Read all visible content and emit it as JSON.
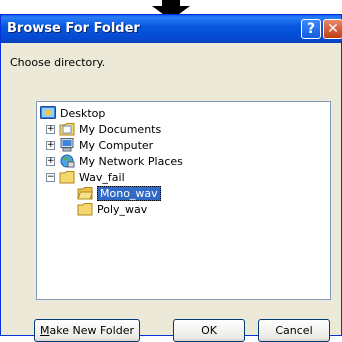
{
  "dialog": {
    "title": "Browse For Folder",
    "help_glyph": "?",
    "close_glyph": "✕",
    "prompt": "Choose directory."
  },
  "tree": {
    "expander_collapsed": "+",
    "expander_expanded": "−",
    "items": [
      {
        "label": "Desktop",
        "icon": "desktop-icon"
      },
      {
        "label": "My Documents",
        "icon": "my-documents-icon",
        "expander": "collapsed"
      },
      {
        "label": "My Computer",
        "icon": "my-computer-icon",
        "expander": "collapsed"
      },
      {
        "label": "My Network Places",
        "icon": "network-places-icon",
        "expander": "collapsed"
      },
      {
        "label": "Wav_fail",
        "icon": "folder-icon",
        "expander": "expanded"
      },
      {
        "label": "Mono_wav",
        "icon": "folder-open-icon",
        "selected": true
      },
      {
        "label": "Poly_wav",
        "icon": "folder-icon"
      }
    ]
  },
  "buttons": {
    "make_new_folder_mnemonic": "M",
    "make_new_folder_rest": "ake New Folder",
    "ok": "OK",
    "cancel": "Cancel"
  }
}
